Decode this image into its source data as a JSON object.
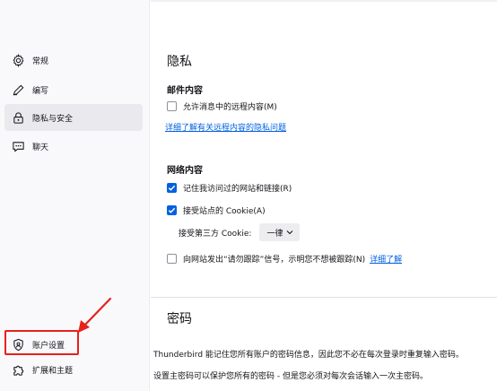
{
  "sidebar": {
    "items": [
      {
        "label": "常规",
        "icon": "gear-icon"
      },
      {
        "label": "编写",
        "icon": "pen-icon"
      },
      {
        "label": "隐私与安全",
        "icon": "lock-icon"
      },
      {
        "label": "聊天",
        "icon": "chat-icon"
      }
    ],
    "bottom_items": [
      {
        "label": "账户设置",
        "icon": "account-shield-icon"
      },
      {
        "label": "扩展和主题",
        "icon": "puzzle-icon"
      }
    ],
    "active_index": 2
  },
  "privacy": {
    "title": "隐私",
    "mail_content": {
      "heading": "邮件内容",
      "allow_remote": {
        "label": "允许消息中的远程内容(M)",
        "checked": false
      },
      "learn_more_link": "详细了解有关远程内容的隐私问题"
    },
    "web_content": {
      "heading": "网络内容",
      "remember_sites": {
        "label": "记住我访问过的网站和链接(R)",
        "checked": true
      },
      "accept_cookies": {
        "label": "接受站点的 Cookie(A)",
        "checked": true
      },
      "third_party_label": "接受第三方 Cookie:",
      "third_party_value": "一律",
      "dnt": {
        "label": "向网站发出“请勿跟踪”信号，示明您不想被跟踪(N)",
        "checked": false
      },
      "dnt_link": "详细了解"
    }
  },
  "password": {
    "title": "密码",
    "line1": "Thunderbird 能记住您所有账户的密码信息，因此您不必在每次登录时重复输入密码。",
    "line2": "设置主密码可以保护您所有的密码 - 但是您必须对每次会话输入一次主密码。"
  },
  "colors": {
    "accent": "#0061e0",
    "annotation_red": "#e8201c",
    "sidebar_bg": "#f9f9fb",
    "active_bg": "#e9e9ee"
  }
}
